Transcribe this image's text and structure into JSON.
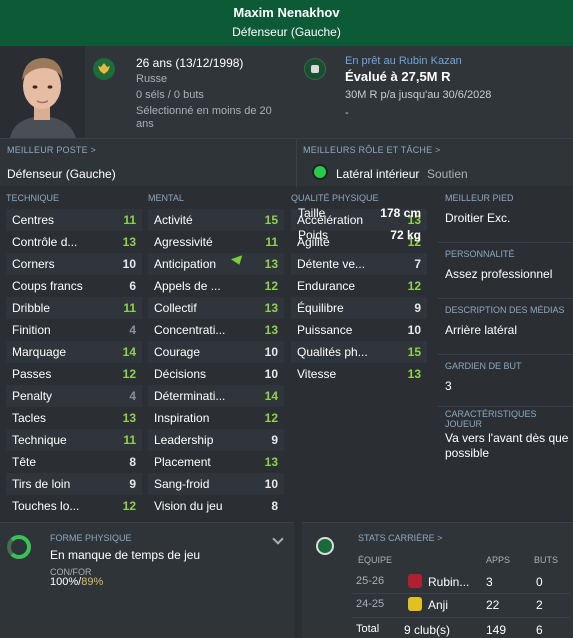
{
  "header": {
    "name": "Maxim Nenakhov",
    "role": "Défenseur (Gauche)"
  },
  "info": {
    "age": "26 ans (13/12/1998)",
    "nationality": "Russe",
    "caps": "0 séls / 0 buts",
    "selection": "Sélectionné en moins de 20 ans",
    "loan": "En prêt au Rubin Kazan",
    "value": "Évalué à 27,5M R",
    "contract": "30M R p/a jusqu'au 30/6/2028",
    "extra": "-"
  },
  "best": {
    "position_label": "MEILLEUR POSTE >",
    "position": "Défenseur (Gauche)",
    "role_label": "MEILLEURS RÔLE ET TÂCHE >",
    "role": "Latéral intérieur",
    "duty": "Soutien"
  },
  "columns": {
    "technique": "TECHNIQUE",
    "mental": "MENTAL",
    "physical": "QUALITÉ PHYSIQUE"
  },
  "technique": [
    {
      "name": "Centres",
      "value": "11",
      "tone": "green"
    },
    {
      "name": "Contrôle d...",
      "value": "13",
      "tone": "green"
    },
    {
      "name": "Corners",
      "value": "10",
      "tone": "white"
    },
    {
      "name": "Coups francs",
      "value": "6",
      "tone": "white"
    },
    {
      "name": "Dribble",
      "value": "11",
      "tone": "green"
    },
    {
      "name": "Finition",
      "value": "4",
      "tone": "grey"
    },
    {
      "name": "Marquage",
      "value": "14",
      "tone": "green"
    },
    {
      "name": "Passes",
      "value": "12",
      "tone": "green"
    },
    {
      "name": "Penalty",
      "value": "4",
      "tone": "grey"
    },
    {
      "name": "Tacles",
      "value": "13",
      "tone": "green"
    },
    {
      "name": "Technique",
      "value": "11",
      "tone": "green"
    },
    {
      "name": "Tête",
      "value": "8",
      "tone": "white"
    },
    {
      "name": "Tirs de loin",
      "value": "9",
      "tone": "white"
    },
    {
      "name": "Touches lo...",
      "value": "12",
      "tone": "green"
    }
  ],
  "mental": [
    {
      "name": "Activité",
      "value": "15",
      "tone": "green"
    },
    {
      "name": "Agressivité",
      "value": "11",
      "tone": "green"
    },
    {
      "name": "Anticipation",
      "value": "13",
      "tone": "green"
    },
    {
      "name": "Appels de ...",
      "value": "12",
      "tone": "green"
    },
    {
      "name": "Collectif",
      "value": "13",
      "tone": "green"
    },
    {
      "name": "Concentrati...",
      "value": "13",
      "tone": "green"
    },
    {
      "name": "Courage",
      "value": "10",
      "tone": "white"
    },
    {
      "name": "Décisions",
      "value": "10",
      "tone": "white"
    },
    {
      "name": "Déterminati...",
      "value": "14",
      "tone": "green"
    },
    {
      "name": "Inspiration",
      "value": "12",
      "tone": "green"
    },
    {
      "name": "Leadership",
      "value": "9",
      "tone": "white"
    },
    {
      "name": "Placement",
      "value": "13",
      "tone": "green"
    },
    {
      "name": "Sang-froid",
      "value": "10",
      "tone": "white"
    },
    {
      "name": "Vision du jeu",
      "value": "8",
      "tone": "white"
    }
  ],
  "physical": [
    {
      "name": "Accélération",
      "value": "13",
      "tone": "green"
    },
    {
      "name": "Agilité",
      "value": "12",
      "tone": "green"
    },
    {
      "name": "Détente ve...",
      "value": "7",
      "tone": "white"
    },
    {
      "name": "Endurance",
      "value": "12",
      "tone": "green"
    },
    {
      "name": "Équilibre",
      "value": "9",
      "tone": "white"
    },
    {
      "name": "Puissance",
      "value": "10",
      "tone": "white"
    },
    {
      "name": "Qualités ph...",
      "value": "15",
      "tone": "green"
    },
    {
      "name": "Vitesse",
      "value": "13",
      "tone": "green"
    }
  ],
  "body": {
    "height_label": "Taille",
    "height": "178 cm",
    "weight_label": "Poids",
    "weight": "72 kg"
  },
  "side": {
    "foot_label": "MEILLEUR PIED",
    "foot": "Droitier Exc.",
    "personality_label": "PERSONNALITÉ",
    "personality": "Assez professionnel",
    "media_label": "DESCRIPTION DES MÉDIAS",
    "media": "Arrière latéral",
    "gk_label": "GARDIEN DE BUT",
    "gk": "3",
    "traits_label": "CARACTÉRISTIQUES JOUEUR",
    "traits": "Va vers l'avant dès que possible"
  },
  "fitness": {
    "label": "FORME PHYSIQUE",
    "status": "En manque de temps de jeu",
    "sub": "CON/FOR",
    "condition": "100%",
    "sharpness": "89%"
  },
  "career": {
    "label": "STATS CARRIÈRE >",
    "headers": {
      "team": "ÉQUIPE",
      "apps": "APPS",
      "goals": "BUTS"
    },
    "rows": [
      {
        "season": "25-26",
        "club": "Rubin...",
        "apps": "3",
        "goals": "0",
        "crest": "#b02030"
      },
      {
        "season": "24-25",
        "club": "Anji",
        "apps": "22",
        "goals": "2",
        "crest": "#e2c020"
      }
    ],
    "total": {
      "label": "Total",
      "clubs": "9 club(s)",
      "apps": "149",
      "goals": "6"
    }
  },
  "colors": {
    "header": "#0d5a36",
    "green_value": "#8fd14f",
    "role_dot": "#29c94a"
  }
}
